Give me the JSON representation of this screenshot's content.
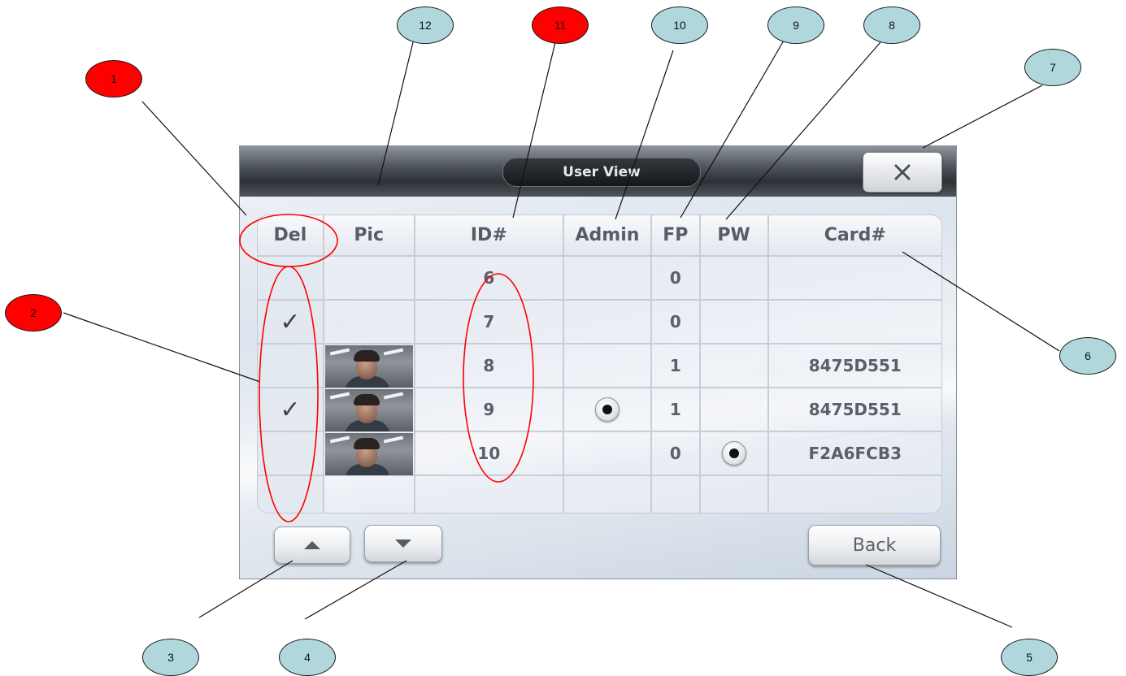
{
  "colors": {
    "bubble_default": "#b0d8dc",
    "bubble_highlight": "#ff0000",
    "annotation_line": "#111111",
    "highlight_ring": "#ff0000"
  },
  "window": {
    "title": "User View"
  },
  "table": {
    "headers": [
      "Del",
      "Pic",
      "ID#",
      "Admin",
      "FP",
      "PW",
      "Card#"
    ],
    "rows": [
      {
        "del_checked": false,
        "has_photo": false,
        "id": "6",
        "admin": false,
        "fp": "0",
        "pw": false,
        "card": ""
      },
      {
        "del_checked": true,
        "has_photo": false,
        "id": "7",
        "admin": false,
        "fp": "0",
        "pw": false,
        "card": ""
      },
      {
        "del_checked": false,
        "has_photo": true,
        "id": "8",
        "admin": false,
        "fp": "1",
        "pw": false,
        "card": "8475D551"
      },
      {
        "del_checked": true,
        "has_photo": true,
        "id": "9",
        "admin": true,
        "fp": "1",
        "pw": false,
        "card": "8475D551"
      },
      {
        "del_checked": false,
        "has_photo": true,
        "id": "10",
        "admin": false,
        "fp": "0",
        "pw": true,
        "card": "F2A6FCB3"
      },
      {
        "del_checked": false,
        "has_photo": false,
        "id": "",
        "admin": false,
        "fp": "",
        "pw": false,
        "card": ""
      }
    ],
    "check_glyph": "✓"
  },
  "icons": {
    "close": "close-icon",
    "up": "arrow-up-icon",
    "down": "arrow-down-icon"
  },
  "buttons": {
    "back_label": "Back"
  },
  "callouts": [
    {
      "label": "1",
      "highlight": true
    },
    {
      "label": "2",
      "highlight": true
    },
    {
      "label": "3",
      "highlight": false
    },
    {
      "label": "4",
      "highlight": false
    },
    {
      "label": "5",
      "highlight": false
    },
    {
      "label": "6",
      "highlight": false
    },
    {
      "label": "7",
      "highlight": false
    },
    {
      "label": "8",
      "highlight": false
    },
    {
      "label": "9",
      "highlight": false
    },
    {
      "label": "10",
      "highlight": false
    },
    {
      "label": "11",
      "highlight": true
    },
    {
      "label": "12",
      "highlight": false
    }
  ]
}
